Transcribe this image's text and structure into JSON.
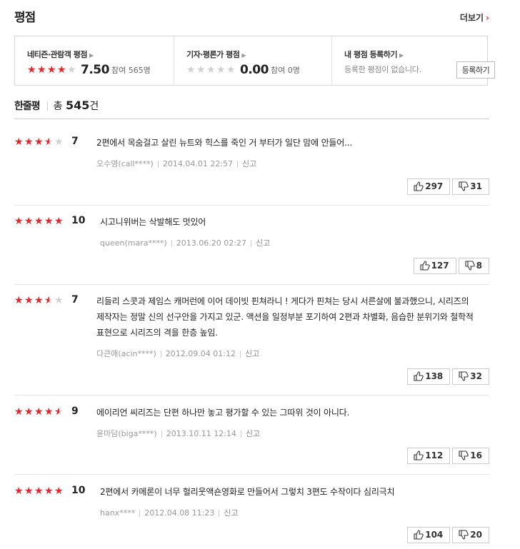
{
  "section": {
    "title": "평점",
    "more_label": "더보기"
  },
  "summary": {
    "netizen": {
      "label": "네티즌·관람객 평점",
      "score": "7.50",
      "participants": "참여 565명",
      "rating": 0.75
    },
    "critic": {
      "label": "기자·평론가 평점",
      "score": "0.00",
      "participants": "참여 0명",
      "rating": 0
    },
    "mine": {
      "label": "내 평점 등록하기",
      "message": "등록한 평점이 없습니다.",
      "button": "등록하기"
    }
  },
  "reviews_header": {
    "label": "한줄평",
    "total_prefix": "총",
    "total": "545",
    "total_suffix": "건"
  },
  "reviews": [
    {
      "stars": 0.7,
      "score": "7",
      "text": "2편에서 목숨걸고 살린 뉴트와 힉스를 죽인 거 부터가 일단 맘에 안들어...",
      "author": "오수영(call****)",
      "date": "2014.04.01 22:57",
      "report": "신고",
      "likes": "297",
      "dislikes": "31"
    },
    {
      "stars": 1.0,
      "score": "10",
      "text": "시고니위버는 삭발해도 멋있어",
      "author": "queen(mara****)",
      "date": "2013.06.20 02:27",
      "report": "신고",
      "likes": "127",
      "dislikes": "8"
    },
    {
      "stars": 0.7,
      "score": "7",
      "text": "리들리 스콧과 제임스 캐머런에 이어 데이빗 핀쳐라니 ! 게다가 핀쳐는 당시 서른살에 불과했으니, 시리즈의 제작자는 정말 신의 선구안을 가지고 있군. 액션을 일정부분 포기하여 2편과 차별화, 음습한 분위기와 철학적 표현으로 시리즈의 격을 한층 높임.",
      "author": "다큰애(acin****)",
      "date": "2012.09.04 01:12",
      "report": "신고",
      "likes": "138",
      "dislikes": "32"
    },
    {
      "stars": 0.9,
      "score": "9",
      "text": "에이리언 씨리즈는 단편 하나만 놓고 평가할 수 있는 그따위 것이 아니다.",
      "author": "윤마담(biga****)",
      "date": "2013.10.11 12:14",
      "report": "신고",
      "likes": "112",
      "dislikes": "16"
    },
    {
      "stars": 1.0,
      "score": "10",
      "text": "2편에서 카메론이 너무 헐리웃액숀영화로 만들어서 그렇치 3편도 수작이다 심리극치",
      "author": "hanx****",
      "date": "2012.04.08 11:23",
      "report": "신고",
      "likes": "104",
      "dislikes": "20"
    }
  ],
  "colors": {
    "star_on": "#e6262a",
    "star_off": "#d0d0d0",
    "accent": "#e0242b"
  },
  "icons": {
    "like": "thumbs-up-icon",
    "dislike": "thumbs-down-icon",
    "more": "chevron-right-icon"
  }
}
